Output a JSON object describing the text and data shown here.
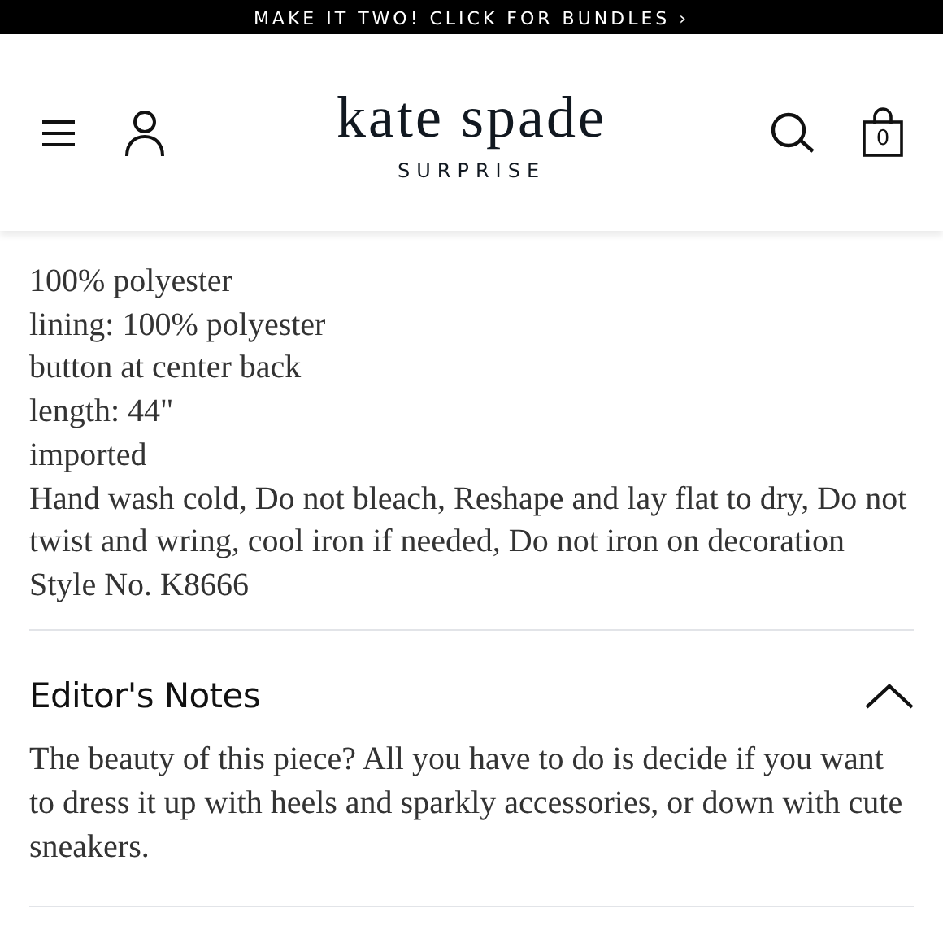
{
  "promo_banner": {
    "text": "MAKE IT TWO! CLICK FOR BUNDLES ›"
  },
  "header": {
    "logo": "kate spade",
    "logo_subtitle": "SURPRISE",
    "bag_count": "0"
  },
  "details": [
    "100% polyester",
    "lining: 100% polyester",
    "button at center back",
    "length: 44\"",
    "imported",
    "Hand wash cold, Do not bleach, Reshape and lay flat to dry, Do not twist and wring, cool iron if needed, Do not iron on decoration",
    "Style No. K8666"
  ],
  "editors_notes": {
    "title": "Editor's Notes",
    "expanded": true,
    "text": "The beauty of this piece? All you have to do is decide if you want to dress it up with heels and sparkly accessories, or down with cute sneakers."
  }
}
